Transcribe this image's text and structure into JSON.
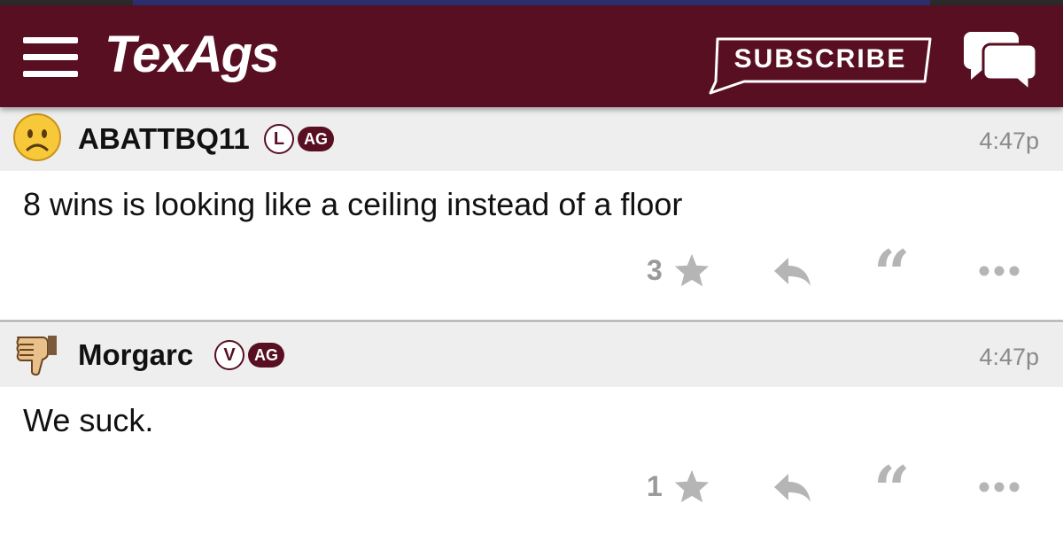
{
  "header": {
    "logo_text": "TexAgs",
    "subscribe_label": "SUBSCRIBE",
    "menu_icon": "hamburger-menu-icon",
    "chat_icon": "chat-bubbles-icon",
    "brand_color": "#580f22"
  },
  "posts": [
    {
      "avatar_icon": "sad-face-icon",
      "username": "ABATTBQ11",
      "badge_letter": "L",
      "badge_ag": "AG",
      "time": "4:47p",
      "text": "8 wins is looking like a ceiling instead of a floor",
      "star_count": "3"
    },
    {
      "avatar_icon": "thumbs-down-icon",
      "username": "Morgarc",
      "badge_letter": "V",
      "badge_ag": "AG",
      "time": "4:47p",
      "text": "We suck.",
      "star_count": "1"
    }
  ]
}
